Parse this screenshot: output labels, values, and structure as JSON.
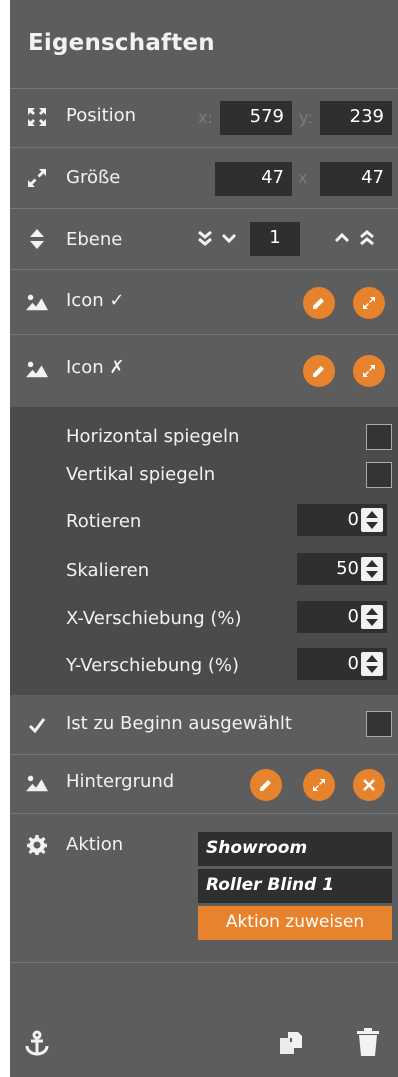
{
  "title": "Eigenschaften",
  "position": {
    "label": "Position",
    "x_label": "x:",
    "x_value": "579",
    "y_label": "y:",
    "y_value": "239"
  },
  "size": {
    "label": "Größe",
    "width": "47",
    "sep": "x",
    "height": "47"
  },
  "layer": {
    "label": "Ebene",
    "value": "1"
  },
  "icon_on": {
    "label": "Icon ✓"
  },
  "icon_off": {
    "label": "Icon ✗"
  },
  "transform": {
    "flip_h": "Horizontal spiegeln",
    "flip_v": "Vertikal spiegeln",
    "rotate": {
      "label": "Rotieren",
      "value": "0"
    },
    "scale": {
      "label": "Skalieren",
      "value": "50"
    },
    "offset_x": {
      "label": "X-Verschiebung (%)",
      "value": "0"
    },
    "offset_y": {
      "label": "Y-Verschiebung (%)",
      "value": "0"
    }
  },
  "initially_selected": {
    "label": "Ist zu Beginn ausgewählt",
    "checked": false
  },
  "background": {
    "label": "Hintergrund"
  },
  "action": {
    "label": "Aktion",
    "room": "Showroom",
    "device": "Roller Blind 1",
    "assign_button": "Aktion zuweisen"
  },
  "colors": {
    "panel": "#5d5d5d",
    "subpanel": "#4b4b4b",
    "input": "#2f2f2f",
    "accent": "#e8832d"
  }
}
